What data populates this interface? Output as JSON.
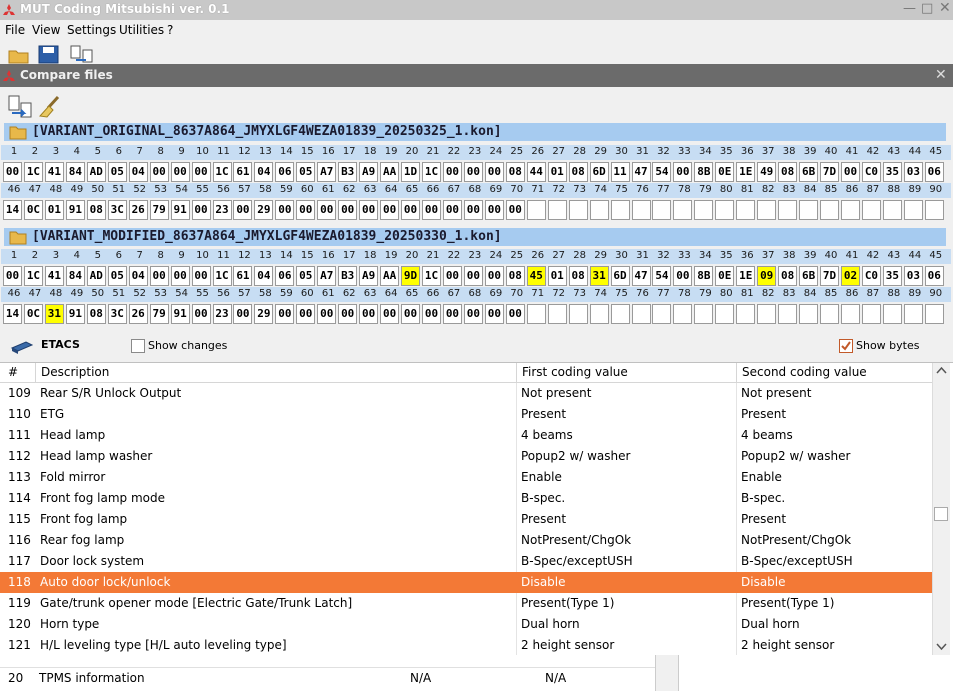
{
  "app": {
    "title": "MUT Coding Mitsubishi  ver. 0.1",
    "menu": [
      "File",
      "View",
      "Settings",
      "Utilities",
      "?"
    ]
  },
  "dialog": {
    "title": "Compare files",
    "variant_original": "[VARIANT_ORIGINAL_8637A864_JMYXLGF4WEZA01839_20250325_1.kon]",
    "variant_modified": "[VARIANT_MODIFIED_8637A864_JMYXLGF4WEZA01839_20250330_1.kon]",
    "original_bytes_1": [
      "00",
      "1C",
      "41",
      "84",
      "AD",
      "05",
      "04",
      "00",
      "00",
      "00",
      "1C",
      "61",
      "04",
      "06",
      "05",
      "A7",
      "B3",
      "A9",
      "AA",
      "1D",
      "1C",
      "00",
      "00",
      "00",
      "08",
      "44",
      "01",
      "08",
      "6D",
      "11",
      "47",
      "54",
      "00",
      "8B",
      "0E",
      "1E",
      "49",
      "08",
      "6B",
      "7D",
      "00",
      "C0",
      "35",
      "03",
      "06"
    ],
    "original_bytes_2": [
      "14",
      "0C",
      "01",
      "91",
      "08",
      "3C",
      "26",
      "79",
      "91",
      "00",
      "23",
      "00",
      "29",
      "00",
      "00",
      "00",
      "00",
      "00",
      "00",
      "00",
      "00",
      "00",
      "00",
      "00",
      "00"
    ],
    "modified_bytes_1": [
      "00",
      "1C",
      "41",
      "84",
      "AD",
      "05",
      "04",
      "00",
      "00",
      "00",
      "1C",
      "61",
      "04",
      "06",
      "05",
      "A7",
      "B3",
      "A9",
      "AA",
      "9D",
      "1C",
      "00",
      "00",
      "00",
      "08",
      "45",
      "01",
      "08",
      "31",
      "6D",
      "47",
      "54",
      "00",
      "8B",
      "0E",
      "1E",
      "09",
      "08",
      "6B",
      "7D",
      "02",
      "C0",
      "35",
      "03",
      "06"
    ],
    "modified_bytes_2": [
      "14",
      "0C",
      "31",
      "91",
      "08",
      "3C",
      "26",
      "79",
      "91",
      "00",
      "23",
      "00",
      "29",
      "00",
      "00",
      "00",
      "00",
      "00",
      "00",
      "00",
      "00",
      "00",
      "00",
      "00",
      "00"
    ],
    "modified_highlight_1": [
      19,
      25,
      28,
      36,
      40
    ],
    "modified_highlight_2": [
      2
    ],
    "highlight_color": "#ffff00",
    "module_name": "ETACS",
    "show_changes_label": "Show changes",
    "show_changes_checked": false,
    "show_bytes_label": "Show bytes",
    "show_bytes_checked": true
  },
  "table": {
    "headers": {
      "num": "#",
      "desc": "Description",
      "first": "First coding value",
      "second": "Second coding value"
    },
    "selected_color": "#f37936",
    "rows": [
      {
        "num": "109",
        "desc": "Rear S/R Unlock Output",
        "first": "Not present",
        "second": "Not present"
      },
      {
        "num": "110",
        "desc": "ETG",
        "first": "Present",
        "second": "Present"
      },
      {
        "num": "111",
        "desc": "Head lamp",
        "first": "4 beams",
        "second": "4 beams"
      },
      {
        "num": "112",
        "desc": "Head lamp washer",
        "first": "Popup2 w/ washer",
        "second": "Popup2 w/ washer"
      },
      {
        "num": "113",
        "desc": "Fold mirror",
        "first": "Enable",
        "second": "Enable"
      },
      {
        "num": "114",
        "desc": "Front fog lamp mode",
        "first": "B-spec.",
        "second": "B-spec."
      },
      {
        "num": "115",
        "desc": "Front fog lamp",
        "first": "Present",
        "second": "Present"
      },
      {
        "num": "116",
        "desc": "Rear fog lamp",
        "first": "NotPresent/ChgOk",
        "second": "NotPresent/ChgOk"
      },
      {
        "num": "117",
        "desc": "Door lock system",
        "first": "B-Spec/exceptUSH",
        "second": "B-Spec/exceptUSH"
      },
      {
        "num": "118",
        "desc": "Auto door lock/unlock",
        "first": "Disable",
        "second": "Disable",
        "selected": true
      },
      {
        "num": "119",
        "desc": "Gate/trunk opener mode  [Electric Gate/Trunk Latch]",
        "first": "Present(Type 1)",
        "second": "Present(Type 1)"
      },
      {
        "num": "120",
        "desc": "Horn type",
        "first": "Dual horn",
        "second": "Dual horn"
      },
      {
        "num": "121",
        "desc": "H/L leveling type  [H/L auto leveling type]",
        "first": "2 height sensor",
        "second": "2 height sensor"
      }
    ]
  },
  "background_list": {
    "row": {
      "num": "20",
      "desc": "TPMS information",
      "first": "N/A",
      "second": "N/A"
    }
  }
}
